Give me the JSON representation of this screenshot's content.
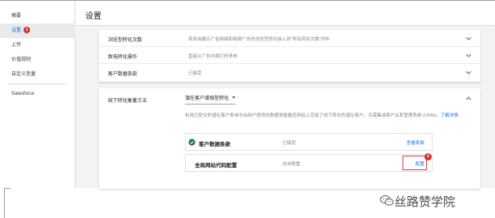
{
  "sidebar": {
    "items": [
      {
        "label": "摘要"
      },
      {
        "label": "设置",
        "badge": "1"
      },
      {
        "label": "上传"
      },
      {
        "label": "价值规则"
      },
      {
        "label": "自定义变量"
      },
      {
        "label": "Salesforce"
      }
    ]
  },
  "header": {
    "title": "设置"
  },
  "settings": [
    {
      "name": "浏览型转化次数",
      "value": "将来自展示广告网络和视频广告的浏览型转化纳入到\"所有转化次数\"列中"
    },
    {
      "name": "致电转化操作",
      "value": "直接从广告中拨打的来电"
    },
    {
      "name": "客户数据条款",
      "value": "已接受"
    }
  ],
  "offline": {
    "label": "线下转化衡量方法",
    "select_value": "潜在客户增强型转化",
    "description": "利用已提交的潜在客户表单中由用户提供的数据来衡量您网站上完成了线下转化的潜在客户。无需集成客户关系管理系统 (CRM)。",
    "learn_more": "了解详情",
    "rows": [
      {
        "name": "客户数据条款",
        "value": "已接受",
        "link": "查看条款",
        "icon": "check-circle-icon"
      },
      {
        "name": "全局网站代码配置",
        "value": "尚未配置",
        "link": "配置",
        "callout": "2"
      }
    ]
  },
  "watermark": {
    "text": "丝路赞学院",
    "icon": "wechat-icon"
  },
  "colors": {
    "accent": "#1a73e8",
    "success": "#188038",
    "alert": "#d93025"
  }
}
